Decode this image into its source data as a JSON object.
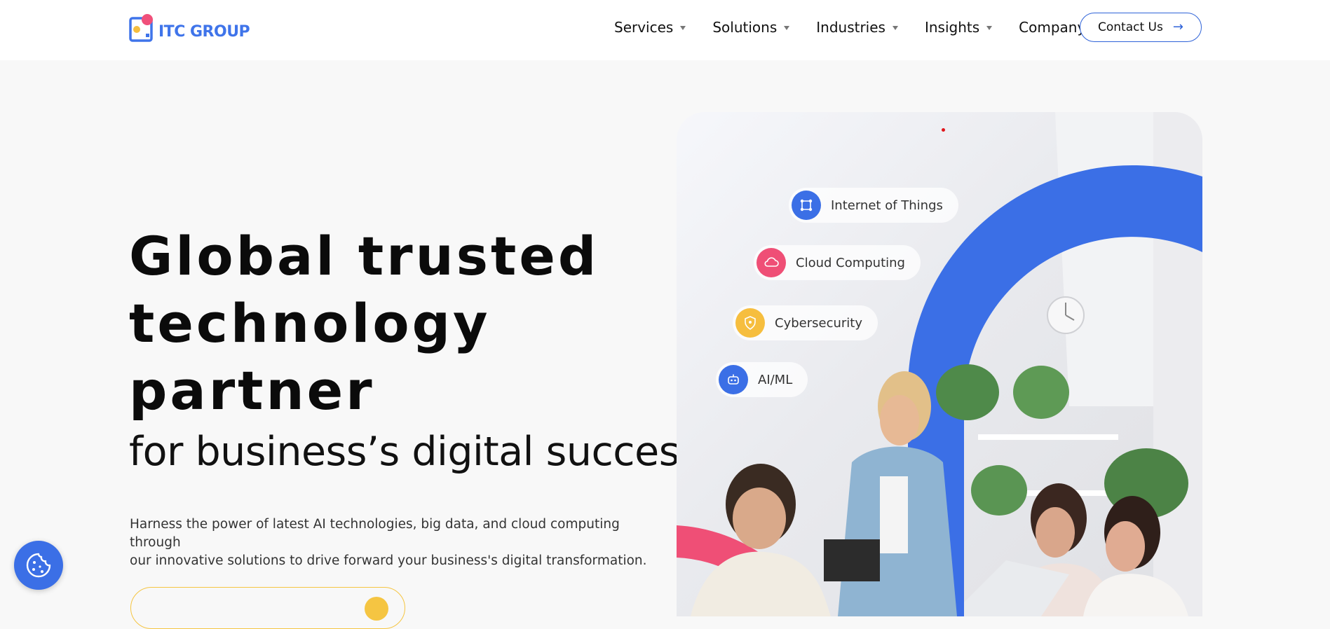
{
  "brand": {
    "name": "ITC GROUP",
    "color": "#3f74ea",
    "accent": "#f0507a"
  },
  "nav": {
    "items": [
      {
        "label": "Services"
      },
      {
        "label": "Solutions"
      },
      {
        "label": "Industries"
      },
      {
        "label": "Insights"
      },
      {
        "label": "Company"
      }
    ],
    "contact_label": "Contact Us",
    "contact_icon": "arrow-right-icon"
  },
  "hero": {
    "title_lines": [
      "Global trusted",
      "technology",
      "partner"
    ],
    "subtitle": "for business’s digital success",
    "description_line1": "Harness the power of latest AI technologies, big data, and cloud computing through",
    "description_line2": "our innovative solutions to drive forward your business's digital transformation."
  },
  "image_tags": [
    {
      "label": "Internet of Things",
      "icon": "iot-icon",
      "color": "#3b6fe6"
    },
    {
      "label": "Cloud Computing",
      "icon": "cloud-icon",
      "color": "#ef4f76"
    },
    {
      "label": "Cybersecurity",
      "icon": "shield-icon",
      "color": "#f6be3e"
    },
    {
      "label": "AI/ML",
      "icon": "robot-icon",
      "color": "#3b6fe6"
    }
  ],
  "colors": {
    "primary_blue": "#3b6fe6",
    "pink": "#ef4f76",
    "yellow": "#f6be3e"
  },
  "cookie_button": {
    "icon": "cookie-icon"
  }
}
